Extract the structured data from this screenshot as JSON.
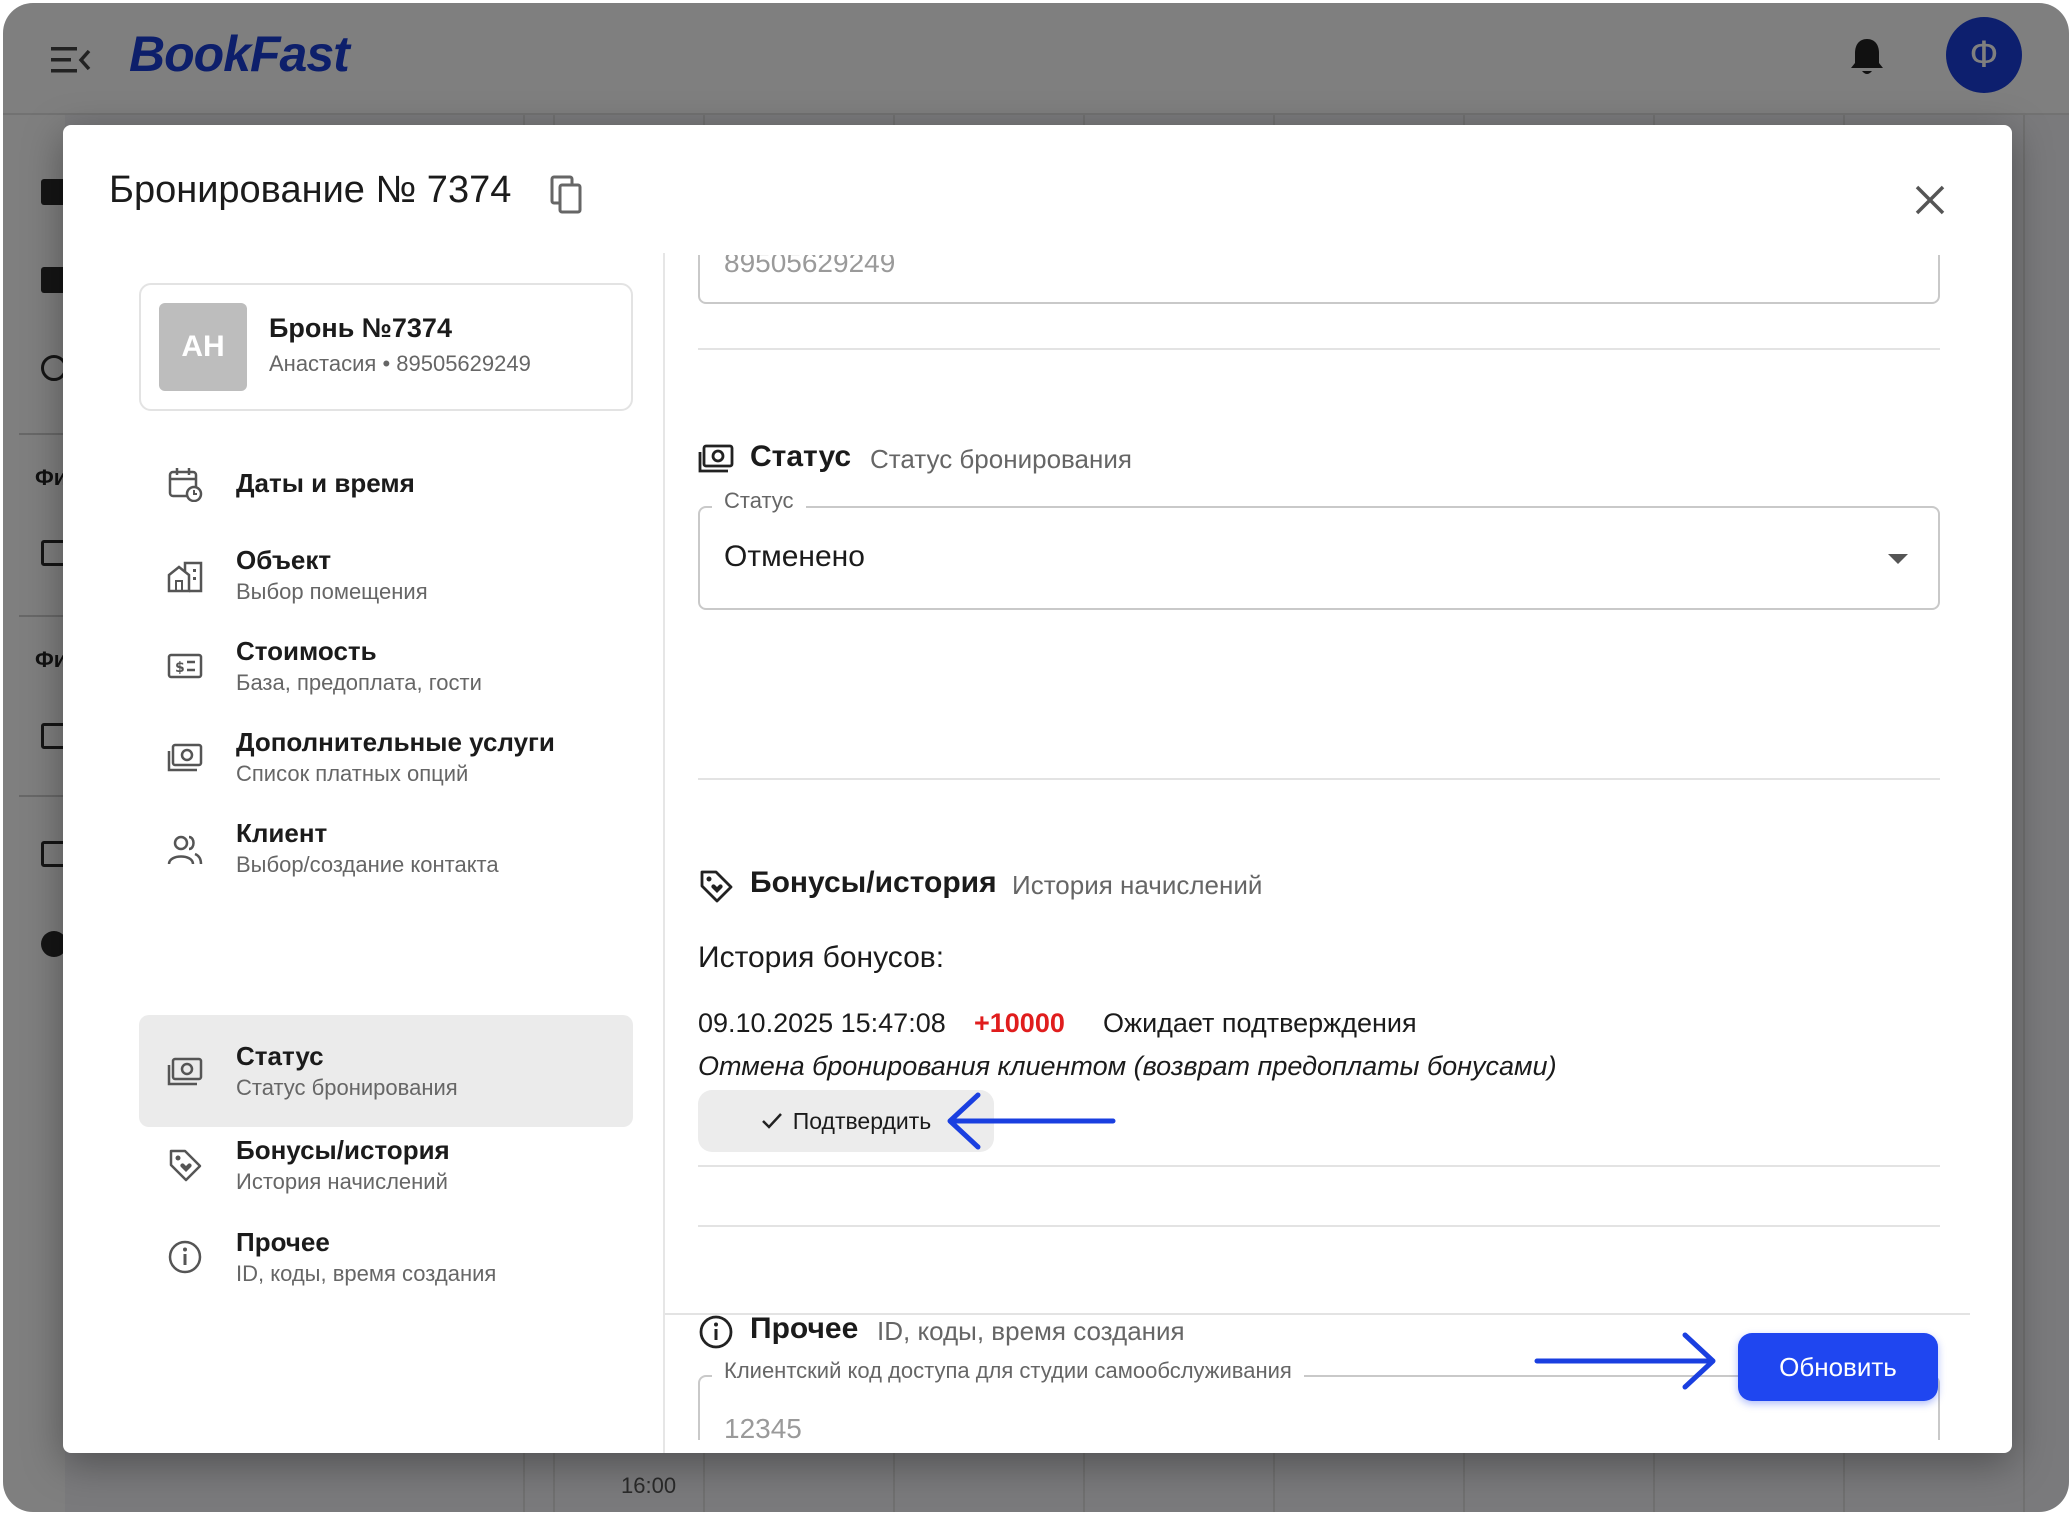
{
  "app": {
    "logo": "BookFast",
    "user_initial": "Ф",
    "rail_labels": [
      "Фи",
      "Фи"
    ],
    "calendar_time": "16:00"
  },
  "modal": {
    "title": "Бронирование № 7374",
    "card": {
      "initials": "АН",
      "title": "Бронь №7374",
      "subtitle": "Анастасия • 89505629249"
    },
    "nav": [
      {
        "title": "Даты и время",
        "subtitle": "",
        "icon": "calendar-clock-icon"
      },
      {
        "title": "Объект",
        "subtitle": "Выбор помещения",
        "icon": "buildings-icon"
      },
      {
        "title": "Стоимость",
        "subtitle": "База, предоплата, гости",
        "icon": "price-tag-icon"
      },
      {
        "title": "Дополнительные услуги",
        "subtitle": "Список платных опций",
        "icon": "cash-icon"
      },
      {
        "title": "Клиент",
        "subtitle": "Выбор/создание контакта",
        "icon": "users-icon"
      },
      {
        "title": "Статус",
        "subtitle": "Статус бронирования",
        "icon": "cash-icon",
        "active": true
      },
      {
        "title": "Бонусы/история",
        "subtitle": "История начислений",
        "icon": "tag-heart-icon"
      },
      {
        "title": "Прочее",
        "subtitle": "ID, коды, время создания",
        "icon": "info-icon"
      }
    ],
    "phone_field_value": "89505629249",
    "status_section": {
      "title": "Статус",
      "subtitle": "Статус бронирования",
      "field_label": "Статус",
      "field_value": "Отменено"
    },
    "bonus_section": {
      "title": "Бонусы/история",
      "subtitle": "История начислений",
      "history_title": "История бонусов:",
      "entry": {
        "date": "09.10.2025 15:47:08",
        "amount": "+10000",
        "status": "Ожидает подтверждения",
        "note": "Отмена бронирования клиентом (возврат предоплаты бонусами)"
      },
      "confirm_label": "Подтвердить"
    },
    "other_section": {
      "title": "Прочее",
      "subtitle": "ID, коды, время создания",
      "field_label": "Клиентский код доступа для студии самообслуживания",
      "field_value": "12345"
    },
    "update_label": "Обновить"
  },
  "colors": {
    "brand": "#1b3fd6",
    "primary_button": "#1f46f0",
    "amount_positive": "#e01d1d",
    "annotation_arrow": "#1a3fe0"
  }
}
